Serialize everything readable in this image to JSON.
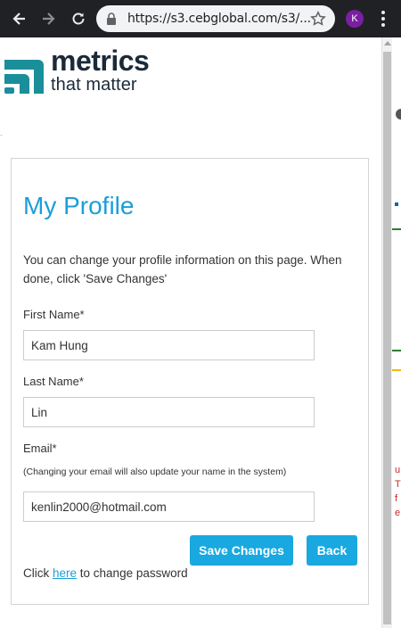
{
  "browser": {
    "url": "https://s3.cebglobal.com/s3/...",
    "profile_initial": "K",
    "profile_color": "#7b1fa2"
  },
  "logo": {
    "title": "metrics",
    "subtitle": "that matter",
    "colors": {
      "teal": "#1a8f9a",
      "navy": "#1b2a3a"
    }
  },
  "profile": {
    "title": "My Profile",
    "intro": "You can change your profile information on this page. When done, click 'Save Changes'",
    "first_name_label": "First Name*",
    "first_name_value": "Kam Hung",
    "last_name_label": "Last Name*",
    "last_name_value": "Lin",
    "email_label": "Email*",
    "email_hint": "(Changing your email will also update your name in the system)",
    "email_value": "kenlin2000@hotmail.com",
    "save_label": "Save Changes",
    "back_label": "Back",
    "pw_prefix": "Click ",
    "pw_link": "here",
    "pw_suffix": " to change password",
    "accent_color": "#1aa8e0"
  },
  "background_peek": {
    "lines": [
      "u",
      "T",
      "f",
      "e"
    ]
  }
}
